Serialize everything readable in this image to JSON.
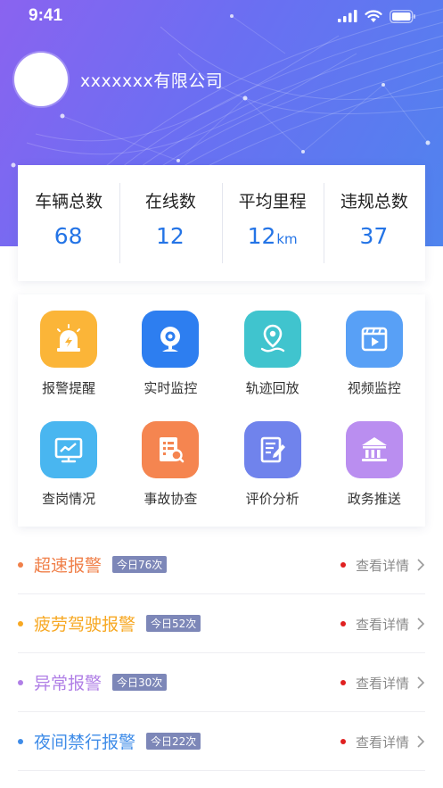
{
  "status_bar": {
    "time": "9:41"
  },
  "profile": {
    "company": "xxxxxxx有限公司"
  },
  "stats": [
    {
      "label": "车辆总数",
      "value": "68",
      "unit": ""
    },
    {
      "label": "在线数",
      "value": "12",
      "unit": ""
    },
    {
      "label": "平均里程",
      "value": "12",
      "unit": "km"
    },
    {
      "label": "违规总数",
      "value": "37",
      "unit": ""
    }
  ],
  "menu": [
    {
      "label": "报警提醒",
      "icon": "alarm-light-icon",
      "color": "#fbb538"
    },
    {
      "label": "实时监控",
      "icon": "webcam-icon",
      "color": "#2d7ef0"
    },
    {
      "label": "轨迹回放",
      "icon": "location-route-icon",
      "color": "#40c4ce"
    },
    {
      "label": "视频监控",
      "icon": "video-player-icon",
      "color": "#58a0f6"
    },
    {
      "label": "查岗情况",
      "icon": "monitor-chart-icon",
      "color": "#49b6f0"
    },
    {
      "label": "事故协查",
      "icon": "document-search-icon",
      "color": "#f58550"
    },
    {
      "label": "评价分析",
      "icon": "document-edit-icon",
      "color": "#7083ec"
    },
    {
      "label": "政务推送",
      "icon": "government-building-icon",
      "color": "#ba8ef0"
    }
  ],
  "alerts": [
    {
      "title": "超速报警",
      "badge": "今日76次",
      "color": "#f0804a"
    },
    {
      "title": "疲劳驾驶报警",
      "badge": "今日52次",
      "color": "#f7a823"
    },
    {
      "title": "异常报警",
      "badge": "今日30次",
      "color": "#b07fe6"
    },
    {
      "title": "夜间禁行报警",
      "badge": "今日22次",
      "color": "#3f8ce8"
    }
  ],
  "alert_detail_label": "查看详情"
}
